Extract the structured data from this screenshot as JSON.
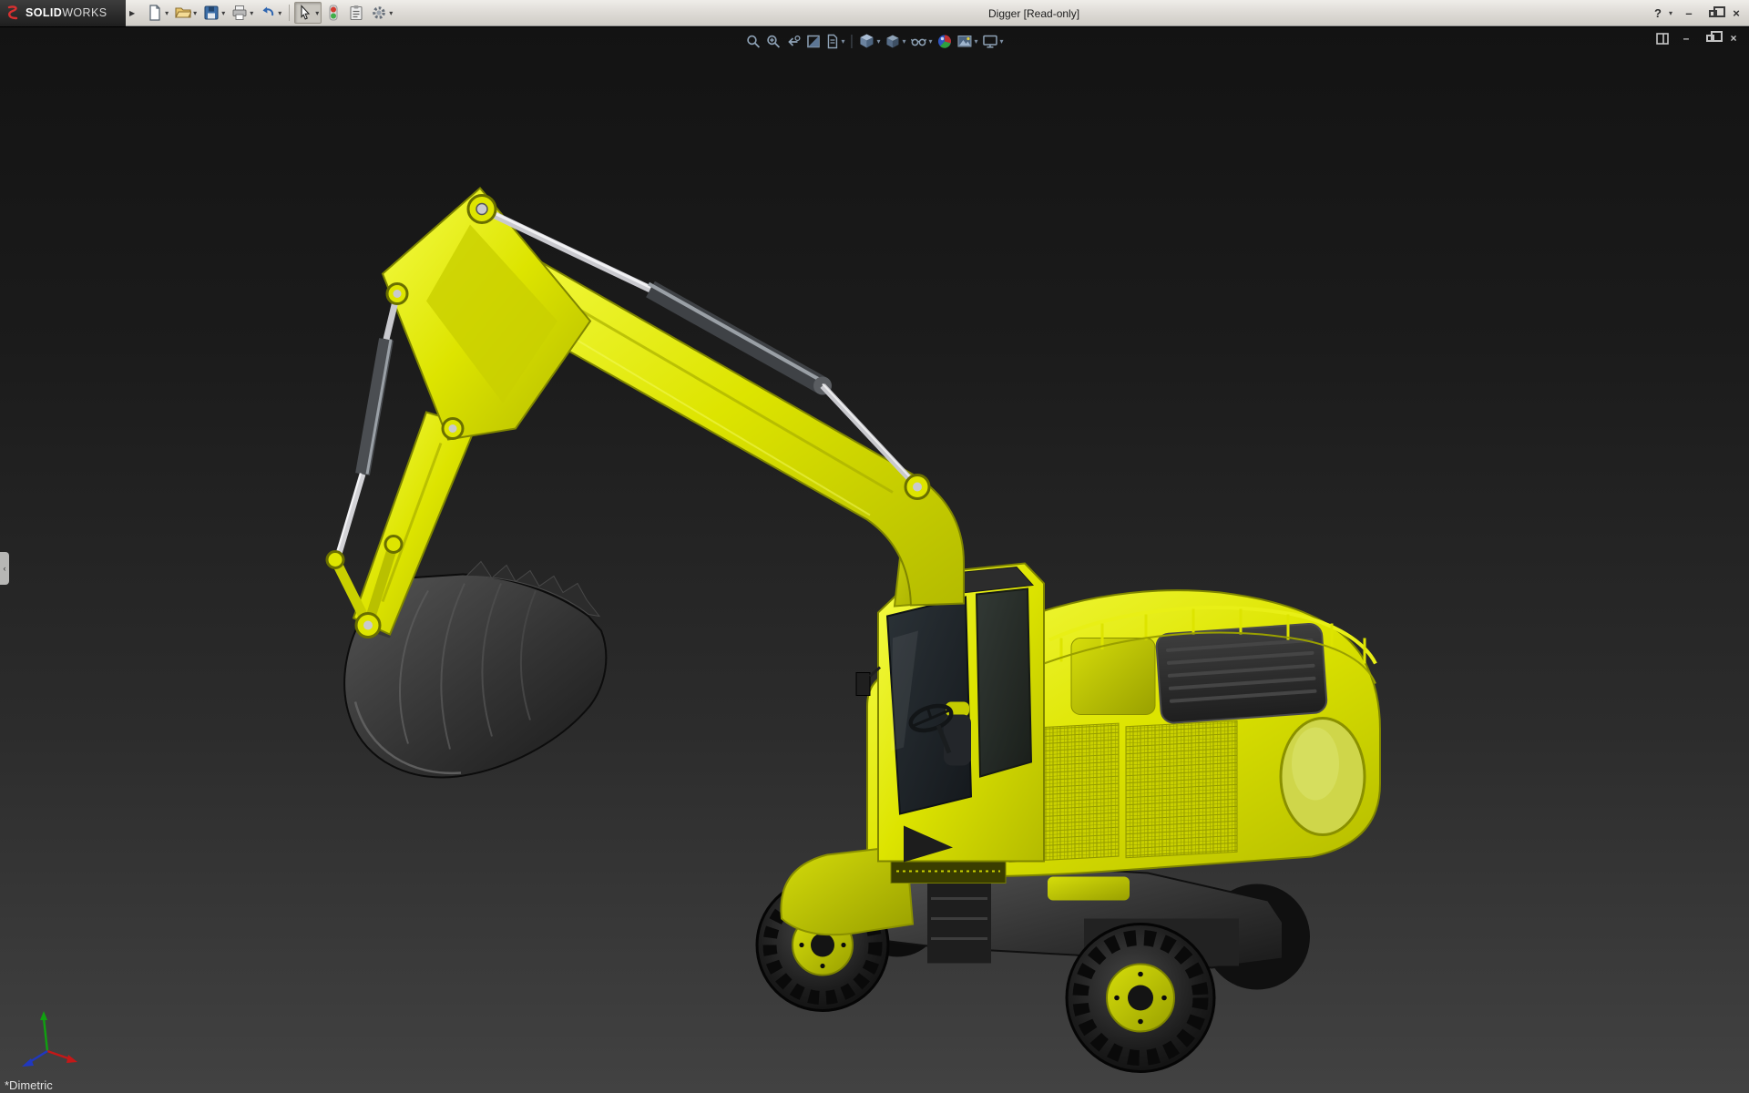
{
  "app": {
    "brand_bold": "SOLID",
    "brand_light": "WORKS",
    "window_title": "Digger [Read-only]",
    "view_label": "*Dimetric"
  },
  "ui": {
    "dropdown_glyph": "▾",
    "minimize_glyph": "–",
    "close_glyph": "×",
    "panel_tab_glyph": "‹",
    "logo_expand_glyph": "▶"
  },
  "titlebar": {
    "help_label": "?",
    "standard_toolbar": [
      {
        "name": "new-document-button",
        "dropdown": true
      },
      {
        "name": "open-button",
        "dropdown": true
      },
      {
        "name": "save-button",
        "dropdown": true
      },
      {
        "name": "print-button",
        "dropdown": true
      },
      {
        "name": "undo-button",
        "dropdown": true
      },
      {
        "name": "select-button",
        "dropdown": true,
        "active": true
      },
      {
        "name": "rebuild-button",
        "dropdown": false
      },
      {
        "name": "file-properties-button",
        "dropdown": false
      },
      {
        "name": "options-button",
        "dropdown": true
      }
    ],
    "window_controls": [
      "minimize-button",
      "restore-button",
      "close-button"
    ]
  },
  "document_controls": [
    "restore-layout-button",
    "minimize-document-button",
    "restore-document-button",
    "close-document-button"
  ],
  "heads_up_toolbar": [
    {
      "name": "zoom-to-fit-button",
      "dropdown": false
    },
    {
      "name": "zoom-to-area-button",
      "dropdown": false
    },
    {
      "name": "previous-view-button",
      "dropdown": false
    },
    {
      "name": "section-view-button",
      "dropdown": false
    },
    {
      "name": "annotations-button",
      "dropdown": true
    },
    {
      "name": "view-orientation-button",
      "dropdown": true
    },
    {
      "name": "display-style-button",
      "dropdown": true
    },
    {
      "name": "hide-show-items-button",
      "dropdown": true
    },
    {
      "name": "edit-appearance-button",
      "dropdown": false
    },
    {
      "name": "apply-scene-button",
      "dropdown": true
    },
    {
      "name": "view-settings-button",
      "dropdown": true
    }
  ],
  "viewport": {
    "background_top": "#131313",
    "background_bottom": "#424242"
  },
  "model": {
    "body_color": "#dde400",
    "dark_parts_color": "#2b2b2b",
    "hydraulic_metal_color": "#c9c9ce",
    "glass_color": "#20262b"
  },
  "triad": {
    "x_color": "#c41818",
    "y_color": "#10a010",
    "z_color": "#2038c0"
  }
}
